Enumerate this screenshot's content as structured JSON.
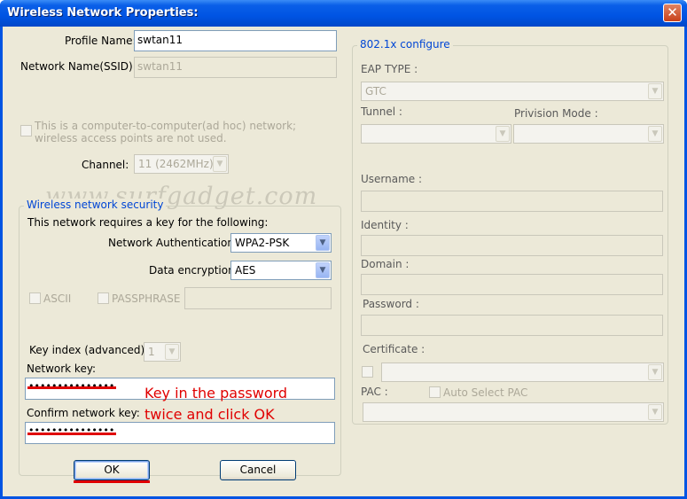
{
  "window": {
    "title": "Wireless Network Properties:",
    "close_glyph": "✕"
  },
  "left": {
    "profile_name_label": "Profile Name:",
    "profile_name_value": "swtan11",
    "ssid_label": "Network Name(SSID):",
    "ssid_value": "swtan11",
    "adhoc_text": "This is a computer-to-computer(ad hoc) network; wireless access points are not used.",
    "channel_label": "Channel:",
    "channel_value": "11 (2462MHz)"
  },
  "watermark": "www.surfgadget.com",
  "security": {
    "group_title": "Wireless network security",
    "intro": "This network requires a key for the following:",
    "auth_label": "Network Authentication:",
    "auth_value": "WPA2-PSK",
    "enc_label": "Data encryption:",
    "enc_value": "AES",
    "ascii_label": "ASCII",
    "passphrase_label": "PASSPHRASE",
    "key_index_label": "Key index (advanced):",
    "key_index_value": "1",
    "network_key_label": "Network key:",
    "network_key_value": "•••••••••••••••",
    "confirm_key_label": "Confirm network key:",
    "confirm_key_value": "•••••••••••••••"
  },
  "annotation": {
    "line1": "Key in the password",
    "line2": "twice and click OK"
  },
  "buttons": {
    "ok": "OK",
    "cancel": "Cancel"
  },
  "dot1x": {
    "group_title": "802.1x configure",
    "eap_label": "EAP TYPE :",
    "eap_value": "GTC",
    "tunnel_label": "Tunnel :",
    "provision_label": "Privision Mode :",
    "username_label": "Username :",
    "identity_label": "Identity :",
    "domain_label": "Domain :",
    "password_label": "Password :",
    "certificate_label": "Certificate :",
    "pac_label": "PAC :",
    "auto_select_pac_label": "Auto Select PAC"
  },
  "colors": {
    "titlebar": "#0054e3",
    "dialog_bg": "#ece9d8",
    "group_title": "#0046d5",
    "annotation": "#e00000"
  }
}
